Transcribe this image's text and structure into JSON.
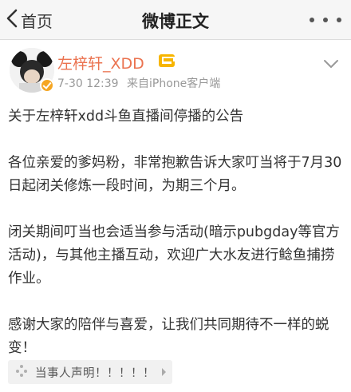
{
  "navbar": {
    "back_label": "首页",
    "title": "微博正文",
    "back_icon": "chevron-left-icon",
    "more_icon": "more-dots-icon"
  },
  "post": {
    "username": "左梓轩_XDD",
    "time": "7-30 12:39",
    "source": "来自iPhone客户端",
    "paragraphs": [
      "关于左梓轩xdd斗鱼直播间停播的公告",
      "各位亲爱的爹妈粉，非常抱歉告诉大家叮当将于7月30日起闭关修炼一段时间，为期三个月。",
      "闭关期间叮当也会适当参与活动(暗示pubgday等官方活动)，与其他主播互动，欢迎广大水友进行鲶鱼捕捞作业。",
      "感谢大家的陪伴与喜爱，让我们共同期待不一样的蜕变！"
    ]
  },
  "footer": {
    "chip_label": "当事人声明！！！！！",
    "chip_icon": "sparkle-icon"
  },
  "colors": {
    "username": "#eb7350",
    "meta": "#999999",
    "verified": "#f5a623",
    "navbar_bg": "#f6f6f6"
  }
}
